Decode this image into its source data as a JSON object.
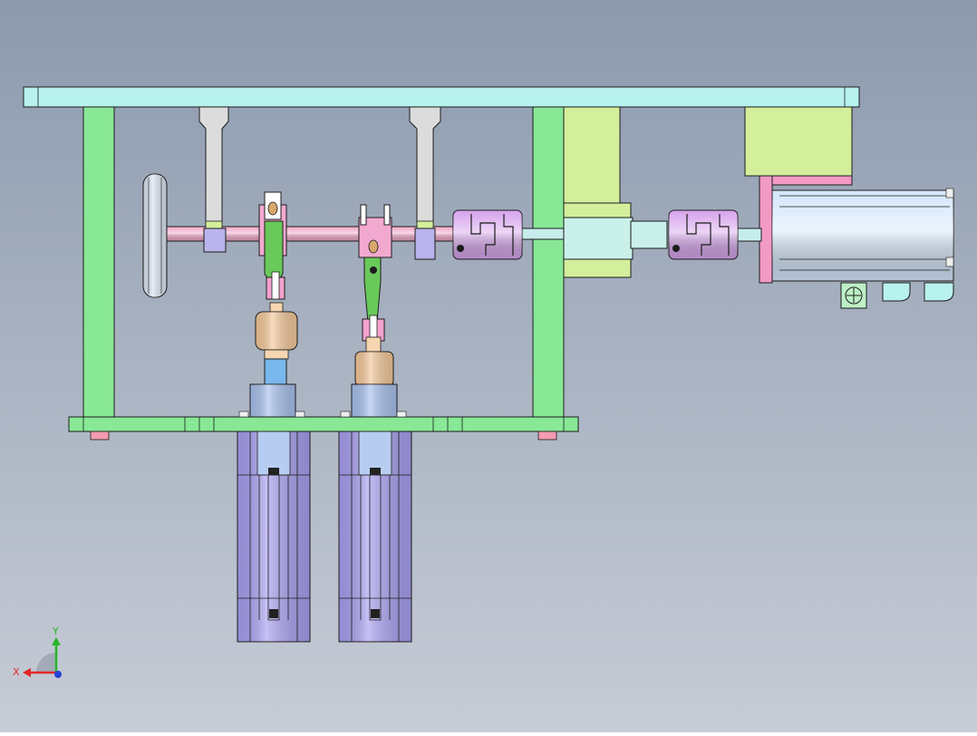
{
  "viewport": {
    "background_top": "#8c9aae",
    "background_bottom": "#c7ccd6"
  },
  "colors": {
    "frame_cyan": "#b8f2ee",
    "frame_green": "#88e896",
    "shaft_pink": "#f0a6c6",
    "bracket_gray": "#dcdcdc",
    "lever_green": "#69c95a",
    "spring_tan": "#f5c99a",
    "cylinder_blue": "#a9c2ee",
    "cylinder_purple": "#a89ff0",
    "coupling_purple": "#d6a3ec",
    "bearing_lime": "#d3ef9c",
    "motor_blue": "#d4e6fb",
    "mount_pink": "#f29ac4",
    "flywheel_blue": "#dde6f3",
    "outline": "#1c1c1c"
  },
  "triad": {
    "x_label": "X",
    "y_label": "Y",
    "x_color": "#e02828",
    "y_color": "#28b428",
    "z_color": "#2840d8"
  },
  "icons": {
    "ground_symbol": "ground-symbol-icon"
  }
}
